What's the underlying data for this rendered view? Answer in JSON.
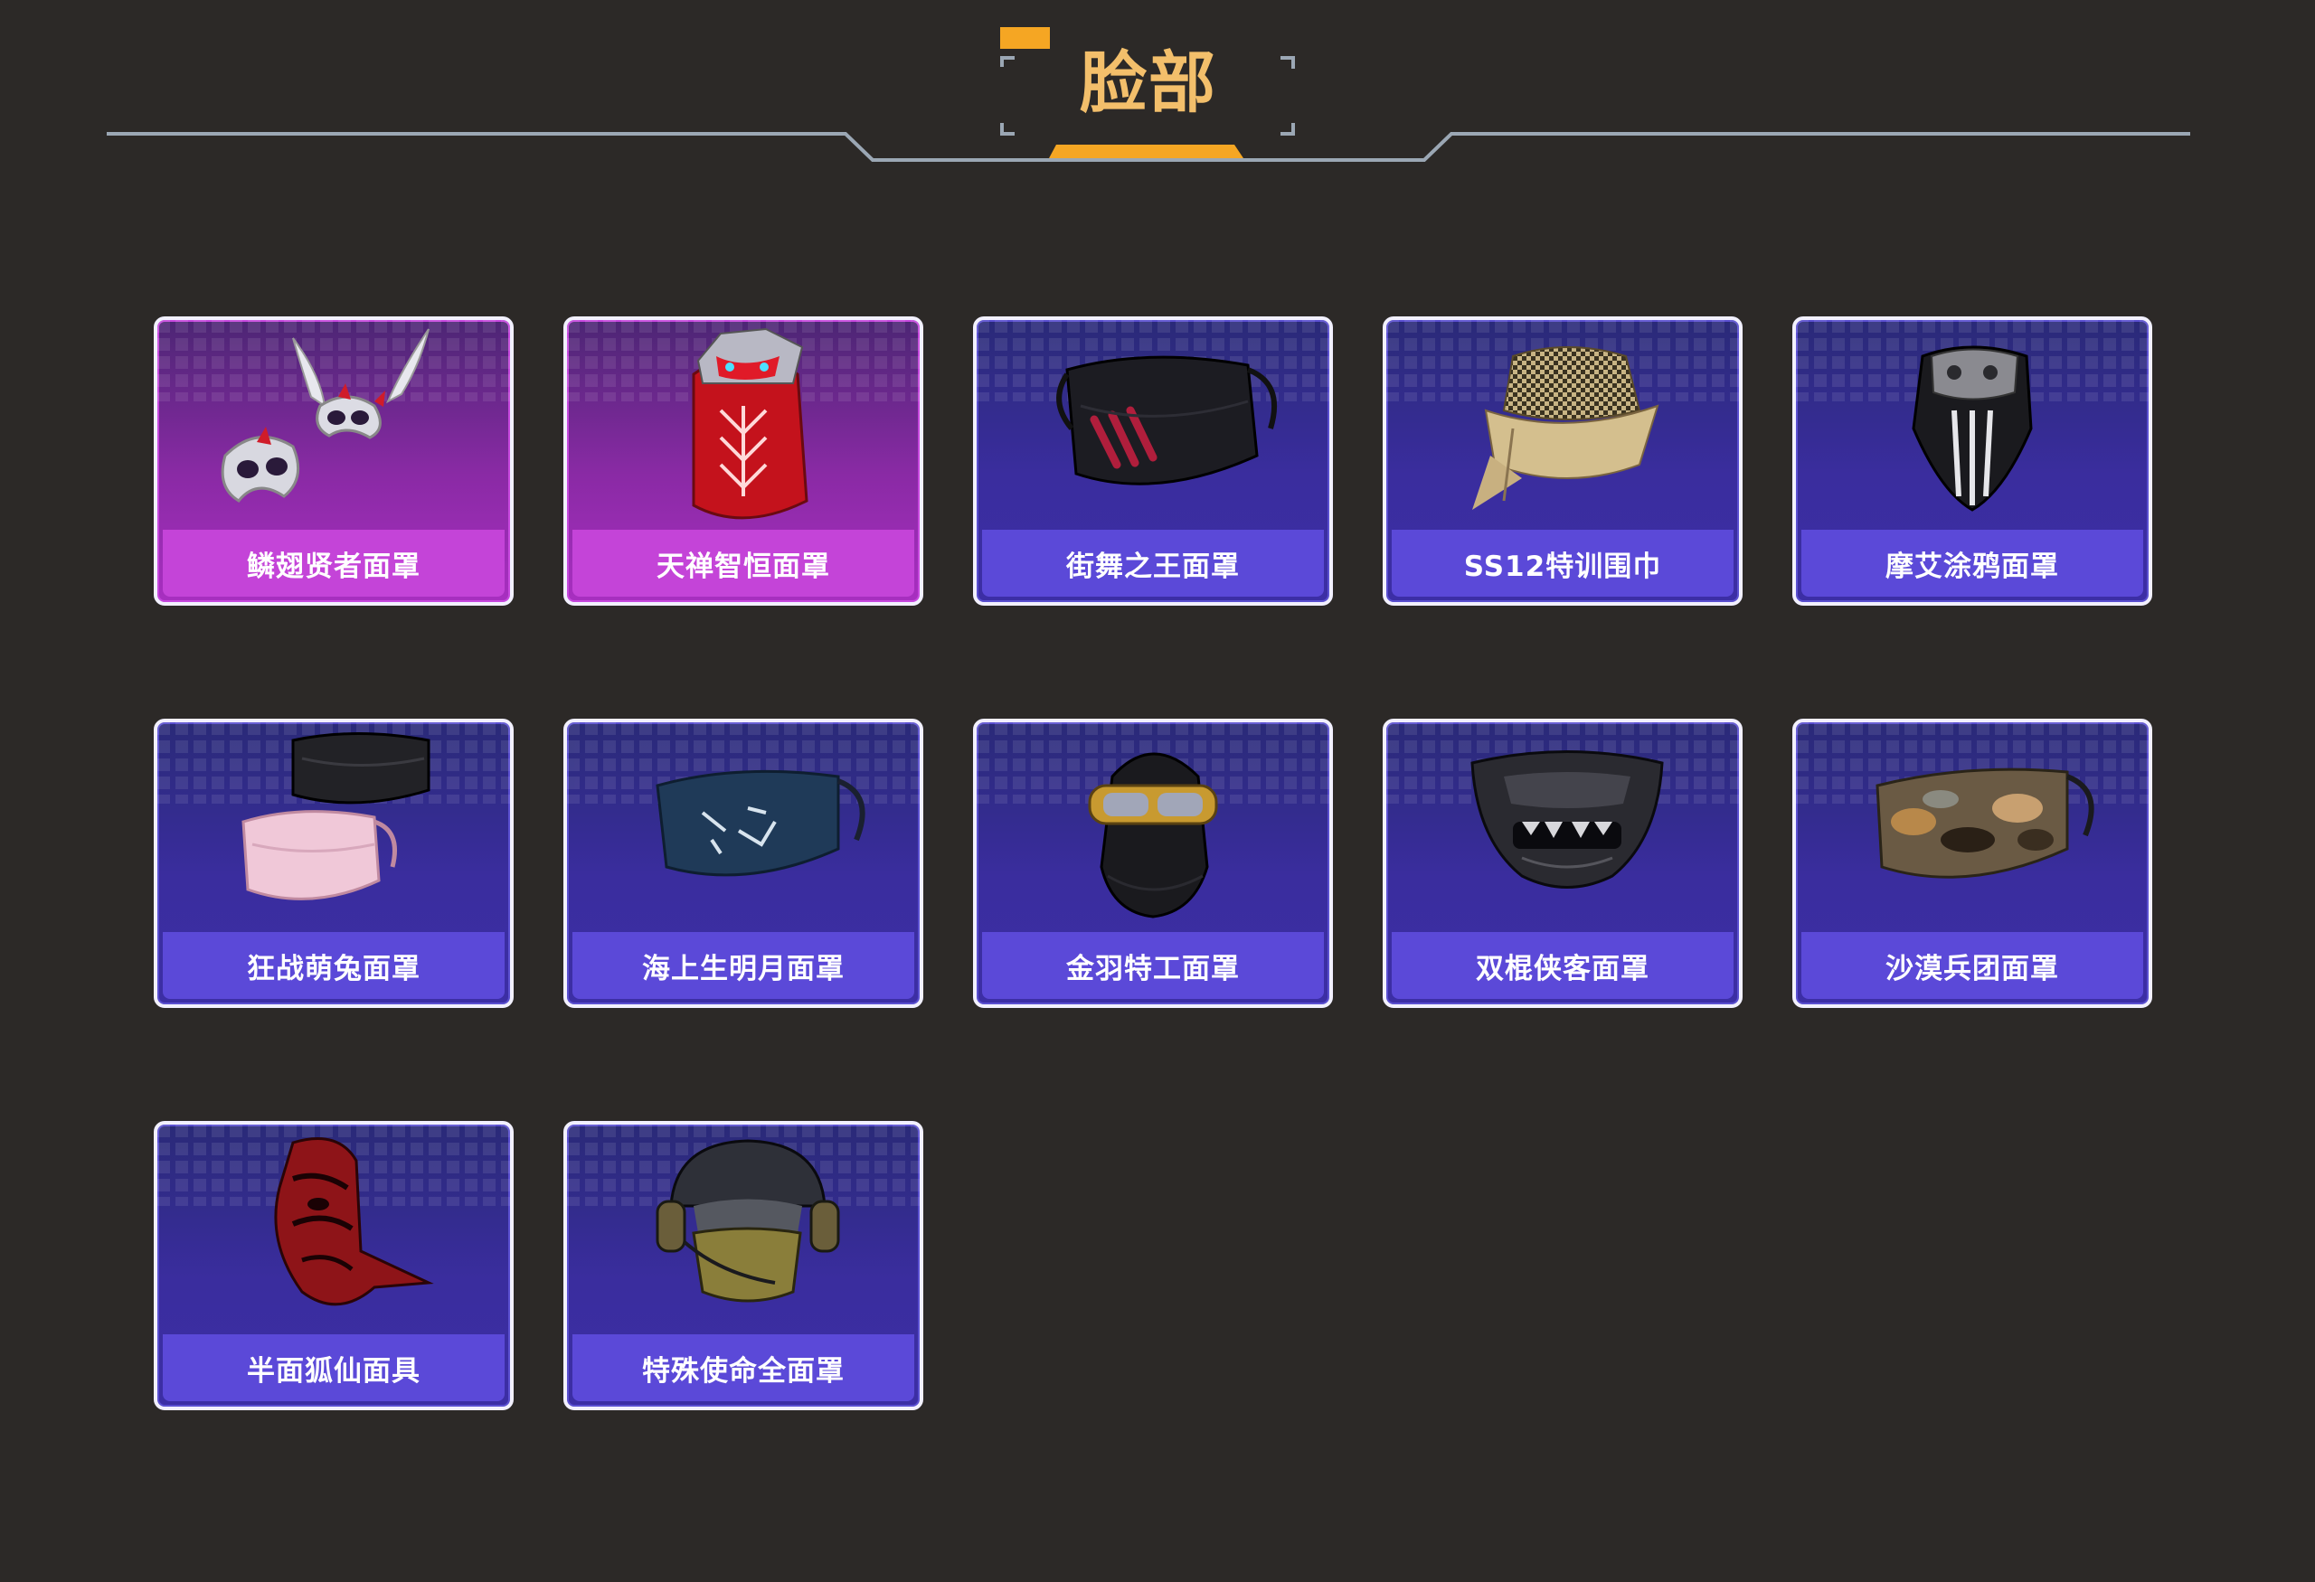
{
  "header": {
    "title": "脸部",
    "accent_color": "#f5a623",
    "line_color": "#9ba7b4",
    "title_color": "#f3bf6b"
  },
  "items": [
    {
      "name": "鳞翅贤者面罩",
      "rarity": "purple",
      "icon": "silver-winged-mask-icon"
    },
    {
      "name": "天禅智恒面罩",
      "rarity": "purple",
      "icon": "red-dragon-mask-icon"
    },
    {
      "name": "街舞之王面罩",
      "rarity": "blue",
      "icon": "black-claw-mask-icon"
    },
    {
      "name": "SS12特训围巾",
      "rarity": "blue",
      "icon": "checkered-scarf-icon"
    },
    {
      "name": "摩艾涂鸦面罩",
      "rarity": "blue",
      "icon": "striped-bandana-icon"
    },
    {
      "name": "狂战萌兔面罩",
      "rarity": "blue",
      "icon": "black-and-pink-masks-icon"
    },
    {
      "name": "海上生明月面罩",
      "rarity": "blue",
      "icon": "navy-floral-mask-icon"
    },
    {
      "name": "金羽特工面罩",
      "rarity": "blue",
      "icon": "balaclava-goggles-icon"
    },
    {
      "name": "双棍侠客面罩",
      "rarity": "blue",
      "icon": "oni-half-mask-icon"
    },
    {
      "name": "沙漠兵团面罩",
      "rarity": "blue",
      "icon": "camo-mask-icon"
    },
    {
      "name": "半面狐仙面具",
      "rarity": "blue",
      "icon": "red-fox-mask-icon"
    },
    {
      "name": "特殊使命全面罩",
      "rarity": "blue",
      "icon": "tactical-helmet-mask-icon"
    }
  ]
}
